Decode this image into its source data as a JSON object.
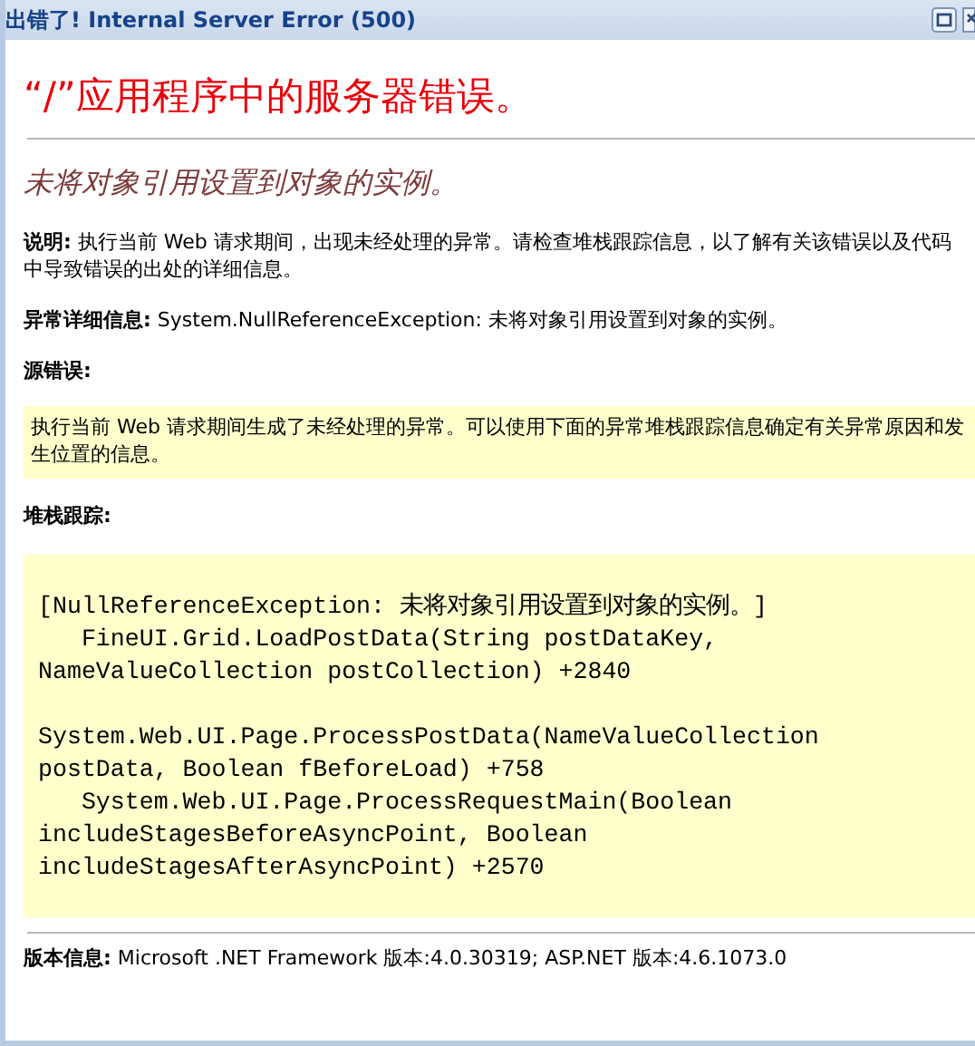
{
  "window": {
    "title": "出错了! Internal Server Error (500)"
  },
  "heading": "“/”应用程序中的服务器错误。",
  "subtitle": "未将对象引用设置到对象的实例。",
  "description": "**说明:** 执行当前 Web 请求期间，出现未经处理的异常。请检查堆栈跟踪信息，以了解有关该错误以及代码中导致错误的出处的详细信息。",
  "exception_details": "**异常详细信息:** System.NullReferenceException: 未将对象引用设置到对象的实例。",
  "source_error": {
    "heading": "源错误:",
    "text": "执行当前 Web 请求期间生成了未经处理的异常。可以使用下面的异常堆栈跟踪信息确定有关异常原因和发生位置的信息。"
  },
  "stack_trace": {
    "heading": "堆栈跟踪:",
    "blocks": [
      [
        "[NullReferenceException: 未将对象引用设置到对象的实例。]",
        "   FineUI.Grid.LoadPostData(String postDataKey,",
        "NameValueCollection postCollection) +2840"
      ],
      [
        "System.Web.UI.Page.ProcessPostData(NameValueCollection",
        "postData, Boolean fBeforeLoad) +758",
        "   System.Web.UI.Page.ProcessRequestMain(Boolean",
        "includeStagesBeforeAsyncPoint, Boolean",
        "includeStagesAfterAsyncPoint) +2570"
      ]
    ]
  },
  "version_info": "**版本信息:** Microsoft .NET Framework 版本:4.0.30319; ASP.NET 版本:4.6.1073.0"
}
